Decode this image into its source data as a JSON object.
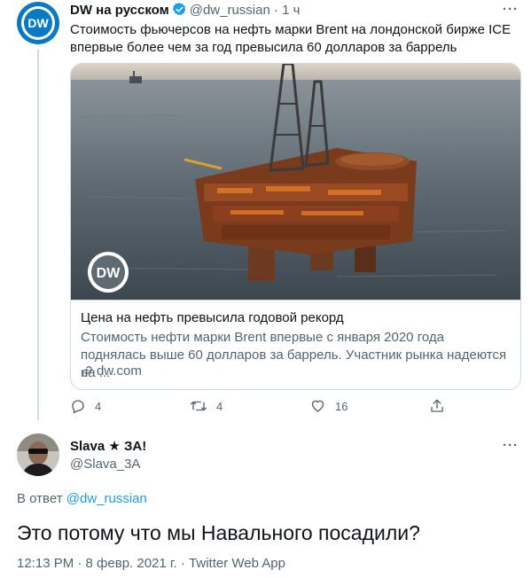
{
  "tweet1": {
    "author_name": "DW на русском",
    "handle": "@dw_russian",
    "separator": "·",
    "time": "1 ч",
    "text": "Стоимость фьючерсов на нефть марки Brent на лондонской бирже ICE впервые более чем за год превысила 60 долларов за баррель",
    "avatar_label": "DW",
    "card": {
      "image_logo": "DW",
      "title": "Цена на нефть превысила годовой рекорд",
      "description": "Стоимость нефти марки Brent впервые с января 2020 года поднялась выше 60 долларов за баррель. Участник рынка надеются на ...",
      "domain": "dw.com"
    },
    "actions": {
      "replies": "4",
      "retweets": "4",
      "likes": "16"
    }
  },
  "tweet2": {
    "author_name": "Slava ★ ЗА!",
    "handle": "@Slava_3A",
    "reply_prefix": "В ответ",
    "reply_to": "@dw_russian",
    "text": "Это потому что мы Навального посадили?",
    "meta": "12:13 PM · 8 февр. 2021 г. · Twitter Web App"
  },
  "icons": {
    "more": "more-dots-icon",
    "verified": "verified-badge-icon",
    "reply": "reply-icon",
    "retweet": "retweet-icon",
    "like": "heart-icon",
    "share": "share-icon",
    "link": "link-icon"
  },
  "colors": {
    "dw_blue": "#0a79c4",
    "verified_blue": "#1d9bf0",
    "link_blue": "#1d9bf0",
    "muted_gray": "#536471",
    "border": "#cfd9de"
  }
}
